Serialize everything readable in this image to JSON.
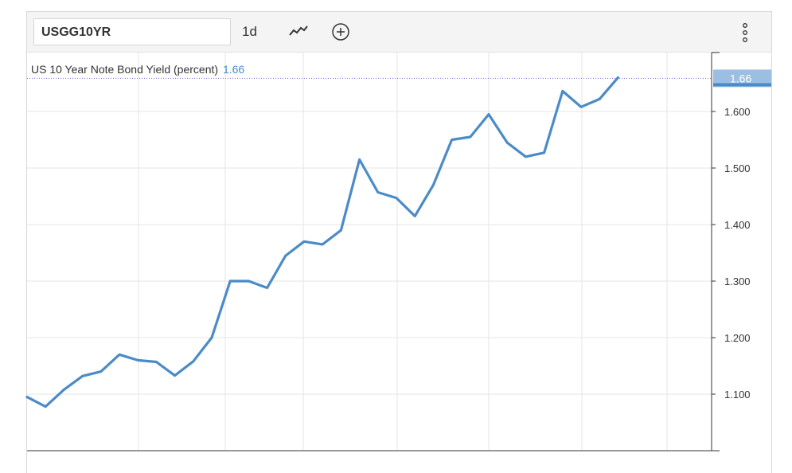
{
  "toolbar": {
    "symbol": "USGG10YR",
    "interval": "1d",
    "icons": [
      "line-chart-icon",
      "add-circle-icon",
      "more-vertical-icon"
    ]
  },
  "legend": {
    "series_name": "US 10 Year Note Bond Yield (percent)",
    "last_value": "1.66"
  },
  "colors": {
    "line": "#4a8bc8",
    "badge": "#4a8bc8",
    "grid": "#e6e6e6"
  },
  "chart_data": {
    "type": "line",
    "series": [
      {
        "name": "US 10 Year Note Bond Yield (percent)",
        "values": [
          1.095,
          1.078,
          1.108,
          1.132,
          1.14,
          1.17,
          1.16,
          1.157,
          1.133,
          1.158,
          1.2,
          1.3,
          1.3,
          1.288,
          1.345,
          1.37,
          1.365,
          1.39,
          1.515,
          1.457,
          1.447,
          1.415,
          1.47,
          1.55,
          1.555,
          1.595,
          1.545,
          1.52,
          1.527,
          1.636,
          1.608,
          1.622,
          1.66
        ]
      }
    ],
    "yticks": [
      "1.100",
      "1.200",
      "1.300",
      "1.400",
      "1.500",
      "1.600"
    ],
    "ylim": [
      1.0,
      1.7
    ],
    "last_value_label": "1.66",
    "grid": true,
    "axis_position": "right"
  }
}
